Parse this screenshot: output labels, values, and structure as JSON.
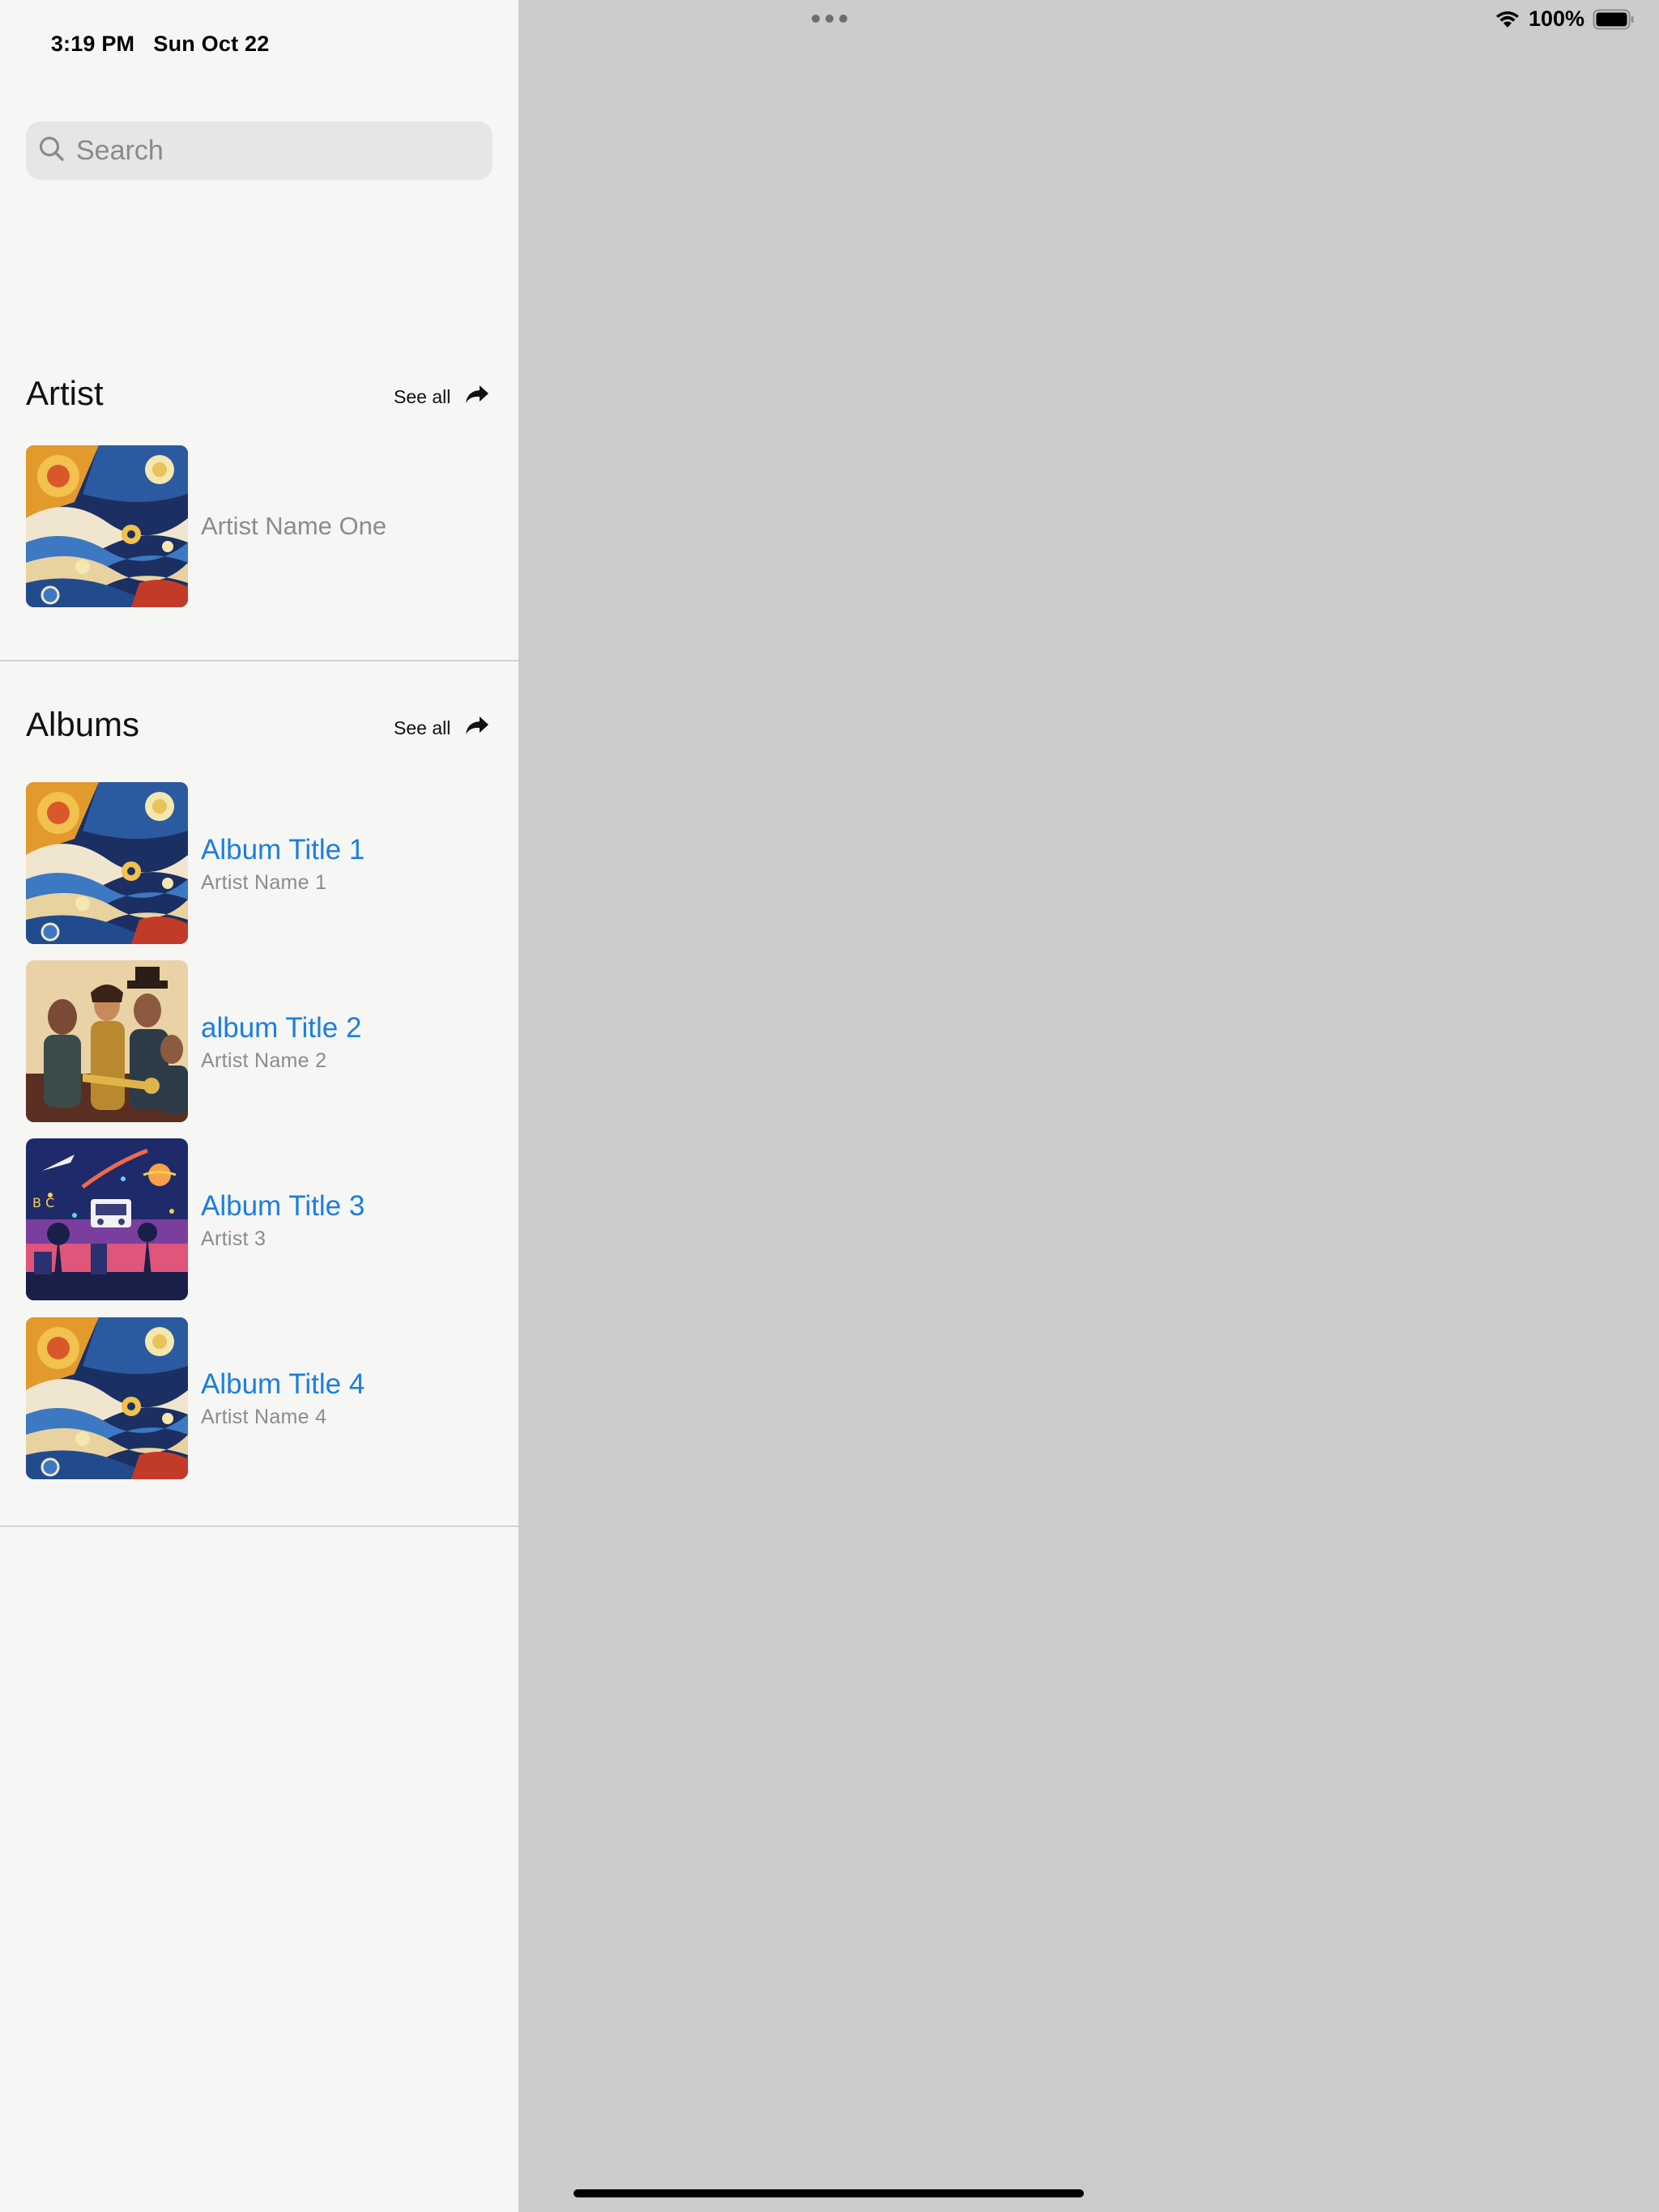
{
  "status_bar": {
    "time": "3:19 PM",
    "date": "Sun Oct 22",
    "battery": "100%",
    "wifi_icon": "wifi-icon",
    "battery_icon": "battery-icon"
  },
  "search": {
    "placeholder": "Search",
    "icon": "search-icon"
  },
  "artist_section": {
    "title": "Artist",
    "see_all_label": "See all",
    "see_all_icon": "share-arrow-icon",
    "items": [
      {
        "name": "Artist Name One",
        "artwork": "swirling-sea-artwork"
      }
    ]
  },
  "albums_section": {
    "title": "Albums",
    "see_all_label": "See all",
    "see_all_icon": "share-arrow-icon",
    "items": [
      {
        "title": "Album Title 1",
        "artist": "Artist Name 1",
        "artwork": "swirling-sea-artwork"
      },
      {
        "title": "album Title 2",
        "artist": "Artist Name 2",
        "artwork": "jazz-band-artwork"
      },
      {
        "title": "Album Title 3",
        "artist": "Artist 3",
        "artwork": "retro-space-artwork"
      },
      {
        "title": "Album Title 4",
        "artist": "Artist Name 4",
        "artwork": "swirling-sea-artwork"
      }
    ]
  },
  "colors": {
    "sidebar_bg": "#f6f6f5",
    "detail_bg": "#cccccc",
    "accent": "#1b7fde",
    "secondary_text": "#8c8c8c"
  }
}
